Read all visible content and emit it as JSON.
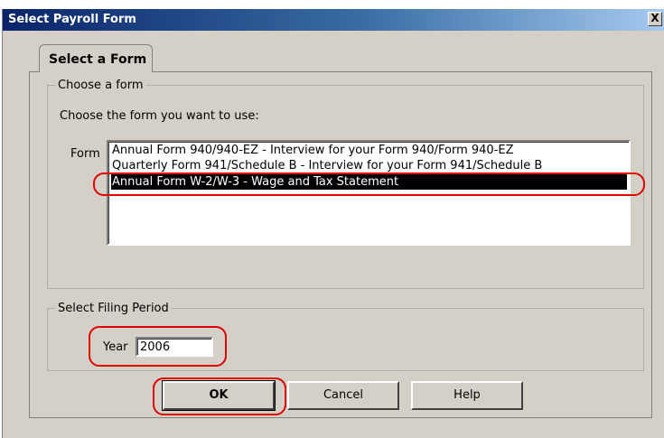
{
  "window": {
    "title": "Select Payroll Form",
    "close_label": "X"
  },
  "tabs": [
    {
      "label": "Select a Form"
    }
  ],
  "choose_form": {
    "legend": "Choose a form",
    "instruction": "Choose the form you want to use:",
    "form_label": "Form",
    "items": [
      {
        "label": "Annual Form 940/940-EZ - Interview for your Form 940/Form 940-EZ",
        "selected": false
      },
      {
        "label": "Quarterly Form 941/Schedule B - Interview for your Form 941/Schedule B",
        "selected": false
      },
      {
        "label": "Annual Form W-2/W-3 - Wage and Tax Statement",
        "selected": true
      }
    ]
  },
  "filing_period": {
    "legend": "Select Filing Period",
    "year_label": "Year",
    "year_value": "2006"
  },
  "buttons": {
    "ok": "OK",
    "cancel": "Cancel",
    "help": "Help"
  },
  "colors": {
    "dialog_bg": "#d4d0c8",
    "titlebar_start": "#0a246a",
    "titlebar_end": "#a6caf0",
    "selection_bg": "#000000",
    "annotation": "#e00000"
  }
}
